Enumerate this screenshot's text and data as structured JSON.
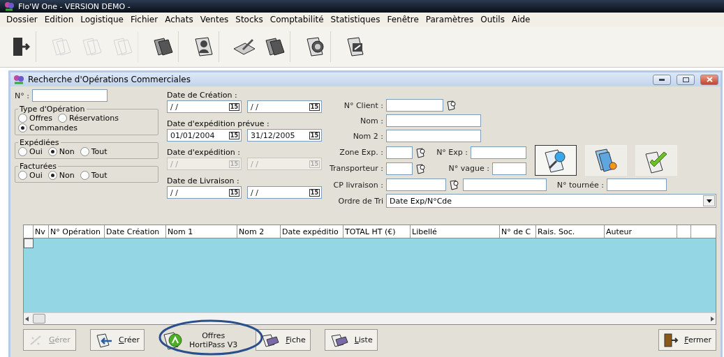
{
  "app_title": "Flo'W One - VERSION DEMO -",
  "menu": [
    "Dossier",
    "Edition",
    "Logistique",
    "Fichier",
    "Achats",
    "Ventes",
    "Stocks",
    "Comptabilité",
    "Statistiques",
    "Fenêtre",
    "Paramètres",
    "Outils",
    "Aide"
  ],
  "toolbar": [
    {
      "kind": "exit",
      "disabled": false
    },
    {
      "kind": "folder",
      "disabled": true
    },
    {
      "kind": "folder",
      "disabled": true
    },
    {
      "kind": "folder",
      "disabled": true
    },
    {
      "kind": "folder",
      "disabled": false
    },
    {
      "kind": "person",
      "disabled": false
    },
    {
      "kind": "pen",
      "disabled": false
    },
    {
      "kind": "folder",
      "disabled": false
    },
    {
      "kind": "coin",
      "disabled": false
    },
    {
      "kind": "screen",
      "disabled": false
    }
  ],
  "window": {
    "title": "Recherche d'Opérations Commerciales"
  },
  "number": {
    "label": "N° :"
  },
  "groups": [
    {
      "title": "Type d'Opération",
      "options": [
        {
          "label": "Offres",
          "selected": false
        },
        {
          "label": "Réservations",
          "selected": false
        },
        {
          "label": "Commandes",
          "selected": true
        }
      ]
    },
    {
      "title": "Expédiées",
      "options": [
        {
          "label": "Oui",
          "selected": false
        },
        {
          "label": "Non",
          "selected": true
        },
        {
          "label": "Tout",
          "selected": false
        }
      ]
    },
    {
      "title": "Facturées",
      "options": [
        {
          "label": "Oui",
          "selected": false
        },
        {
          "label": "Non",
          "selected": true
        },
        {
          "label": "Tout",
          "selected": false
        }
      ]
    }
  ],
  "dates": [
    {
      "label": "Date de Création :",
      "disabled": false,
      "from": {
        "value": "/ /",
        "button": "15"
      },
      "to": {
        "value": "/ /",
        "button": "15"
      }
    },
    {
      "label": "Date d'expédition prévue :",
      "disabled": false,
      "from": {
        "value": "01/01/2004",
        "button": "15"
      },
      "to": {
        "value": "31/12/2005",
        "button": "15"
      }
    },
    {
      "label": "Date d'expédition :",
      "disabled": true,
      "from": {
        "value": "/ /",
        "button": "15"
      },
      "to": {
        "value": "/ /",
        "button": "15"
      }
    },
    {
      "label": "Date de Livraison :",
      "disabled": false,
      "from": {
        "value": "/ /",
        "button": "15"
      },
      "to": {
        "value": "/ /",
        "button": "15"
      }
    }
  ],
  "client": {
    "label": "N° Client :"
  },
  "nom": {
    "label": "Nom :"
  },
  "nom2": {
    "label": "Nom 2 :"
  },
  "zone": {
    "label": "Zone Exp. :"
  },
  "n_exp": {
    "label": "N° Exp :"
  },
  "transporteur": {
    "label": "Transporteur :"
  },
  "n_vague": {
    "label": "N° vague :"
  },
  "cp": {
    "label": "CP livraison :"
  },
  "n_tournee": {
    "label": "N° tournée :"
  },
  "sort": {
    "label": "Ordre de Tri",
    "value": "Date Exp/N°Cde"
  },
  "action_buttons": [
    {
      "kind": "search",
      "pressed": true
    },
    {
      "kind": "new",
      "pressed": false
    },
    {
      "kind": "validate",
      "pressed": false
    }
  ],
  "table": {
    "columns": [
      "Nv",
      "N° Opération",
      "Date Création",
      "Nom 1",
      "Nom 2",
      "Date expéditio",
      "TOTAL HT (€)",
      "Libellé",
      "N° de C",
      "Rais. Soc.",
      "Auteur"
    ]
  },
  "buttons": [
    {
      "label": "Gérer",
      "kind": "manage",
      "disabled": true,
      "highlighted": false
    },
    {
      "label": "Créer",
      "kind": "create",
      "disabled": false,
      "highlighted": false
    },
    {
      "label": "Offres\nHortiPass V3",
      "kind": "hortipass",
      "disabled": false,
      "highlighted": true
    },
    {
      "label": "Fiche",
      "kind": "sheet",
      "disabled": false,
      "highlighted": false
    },
    {
      "label": "Liste",
      "kind": "list",
      "disabled": false,
      "highlighted": false
    },
    {
      "label": "Fermer",
      "kind": "close",
      "disabled": false,
      "highlighted": false
    }
  ]
}
